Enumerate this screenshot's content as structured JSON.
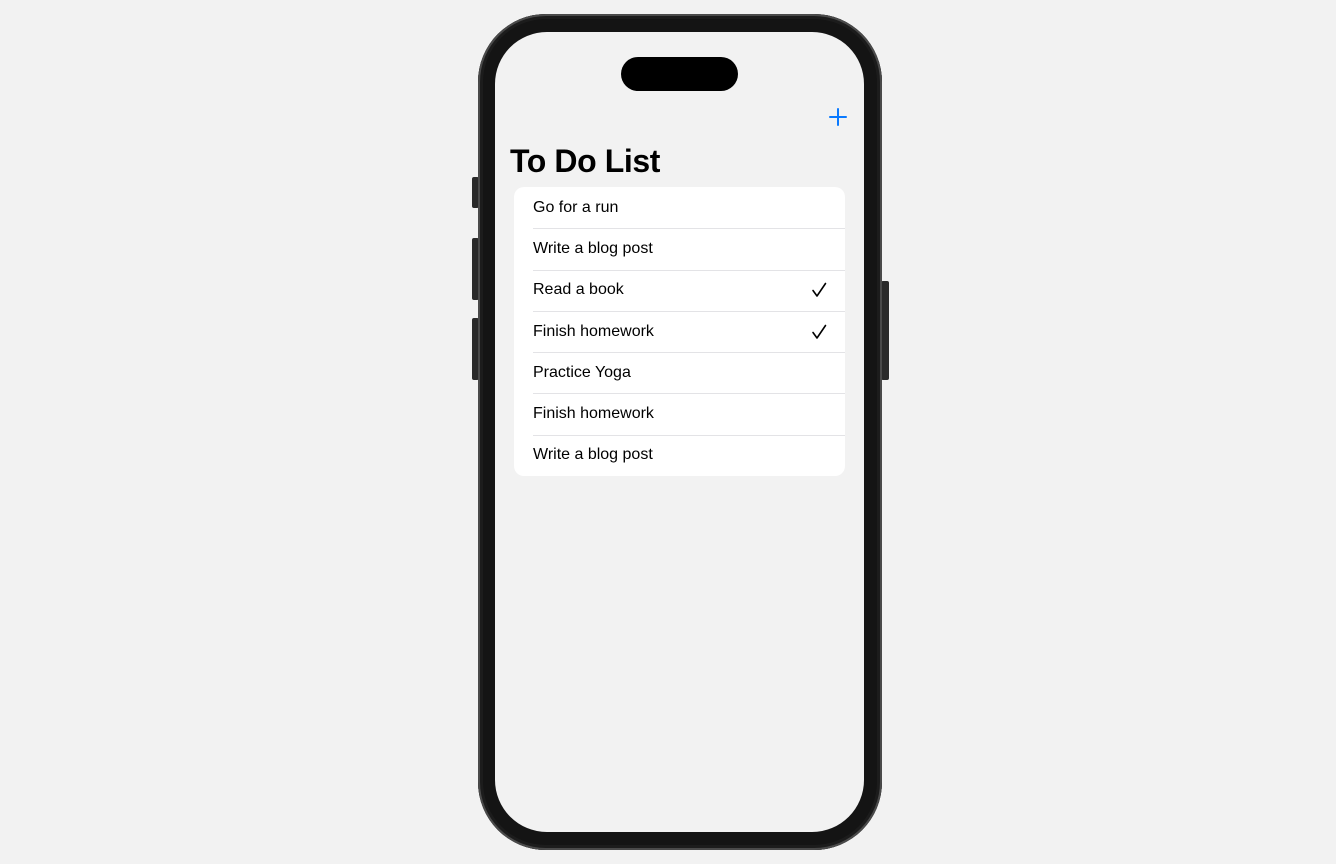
{
  "header": {
    "title": "To Do List",
    "add_icon": "plus-icon",
    "accent_color": "#0a7aff"
  },
  "todos": [
    {
      "label": "Go for a run",
      "done": false
    },
    {
      "label": "Write a blog post",
      "done": false
    },
    {
      "label": "Read a book",
      "done": true
    },
    {
      "label": "Finish homework",
      "done": true
    },
    {
      "label": "Practice Yoga",
      "done": false
    },
    {
      "label": "Finish homework",
      "done": false
    },
    {
      "label": "Write a blog post",
      "done": false
    }
  ],
  "icons": {
    "check": "checkmark-icon"
  }
}
